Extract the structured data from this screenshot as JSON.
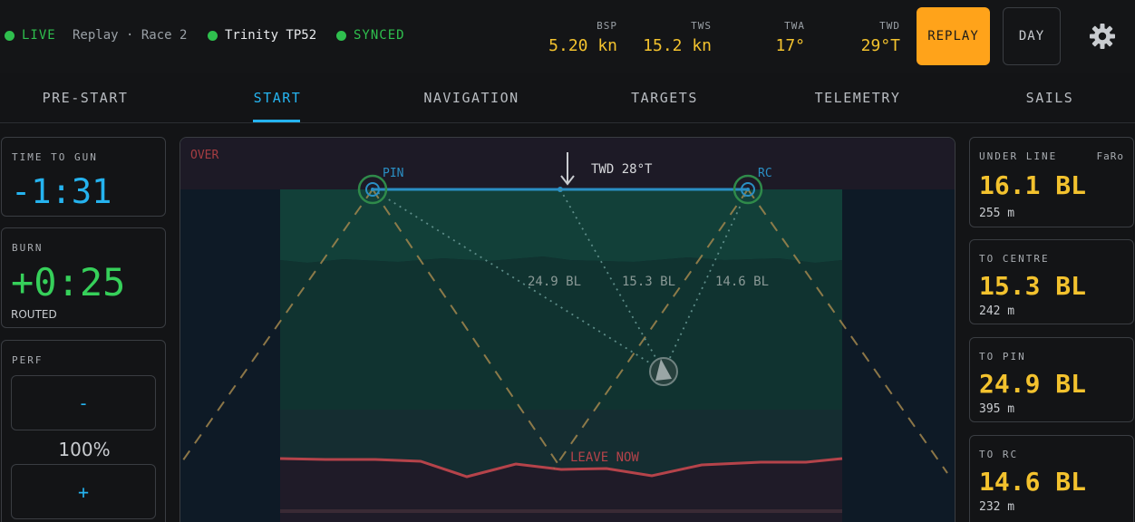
{
  "status": {
    "live": "LIVE",
    "session": "Replay · Race 2",
    "boat": "Trinity TP52",
    "sync": "SYNCED"
  },
  "metrics": {
    "bsp": {
      "label": "BSP",
      "value": "5.20 kn"
    },
    "tws": {
      "label": "TWS",
      "value": "15.2 kn"
    },
    "twa": {
      "label": "TWA",
      "value": "17°"
    },
    "twd": {
      "label": "TWD",
      "value": "29°T"
    }
  },
  "buttons": {
    "replay": "REPLAY",
    "day": "DAY"
  },
  "tabs": [
    "PRE-START",
    "START",
    "NAVIGATION",
    "TARGETS",
    "TELEMETRY",
    "SAILS"
  ],
  "active_tab": "START",
  "left": {
    "time_to_gun": {
      "label": "TIME TO GUN",
      "value": "-1:31"
    },
    "burn": {
      "label": "BURN",
      "value": "+0:25",
      "sub": "ROUTED"
    },
    "perf": {
      "label": "PERF",
      "minus": "-",
      "value": "100%",
      "plus": "+"
    }
  },
  "map": {
    "over_label": "OVER",
    "pin_label": "PIN",
    "rc_label": "RC",
    "wind_label": "TWD 28°T",
    "dist_pin": "24.9 BL",
    "dist_centre": "15.3 BL",
    "dist_rc": "14.6 BL",
    "leave_label": "LEAVE NOW"
  },
  "right": {
    "under_line": {
      "label": "UNDER LINE",
      "tag": "FaRo",
      "value": "16.1 BL",
      "sub": "255 m"
    },
    "to_centre": {
      "label": "TO CENTRE",
      "value": "15.3 BL",
      "sub": "242 m"
    },
    "to_pin": {
      "label": "TO PIN",
      "value": "24.9 BL",
      "sub": "395 m"
    },
    "to_rc": {
      "label": "TO RC",
      "value": "14.6 BL",
      "sub": "232 m"
    }
  },
  "colors": {
    "accent": "#25b3ef",
    "value_yellow": "#f3c22e",
    "live_green": "#2fbf4e",
    "replay_orange": "#ffa31a",
    "leave_red": "#c0464a"
  },
  "icons": {
    "settings": "gear-icon"
  }
}
